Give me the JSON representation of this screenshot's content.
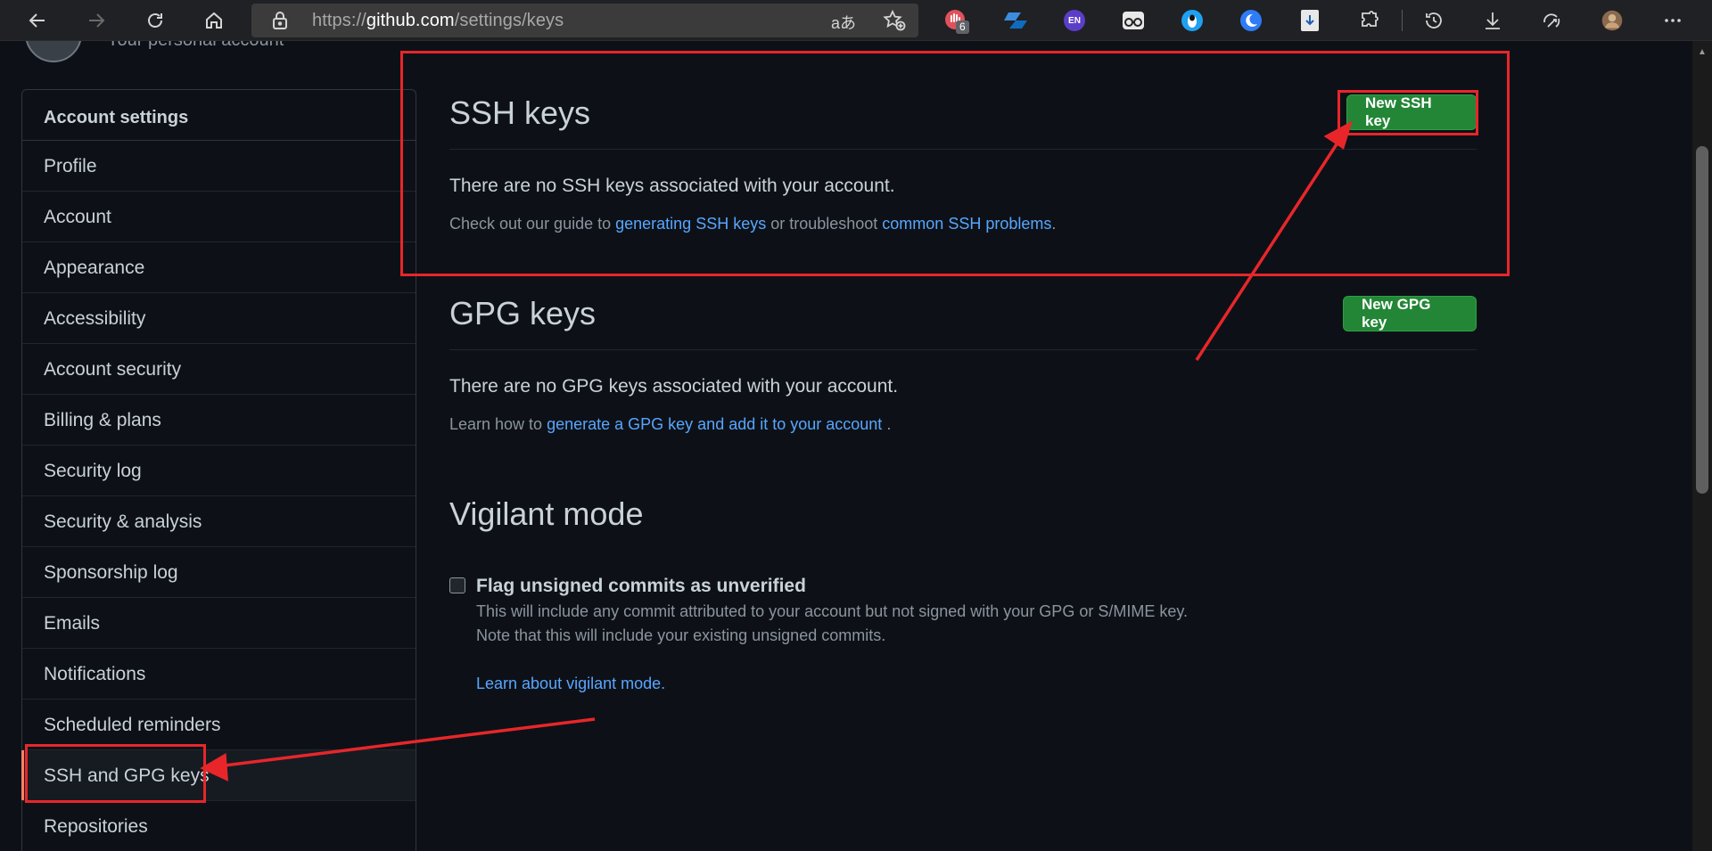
{
  "browser": {
    "url_prefix": "https://",
    "url_host": "github.com",
    "url_path": "/settings/keys",
    "read_aloud": "aあ",
    "ext_badge_count": "6",
    "ext_en_label": "EN"
  },
  "profile": {
    "subtitle": "Your personal account"
  },
  "sidebar": {
    "heading": "Account settings",
    "items": [
      {
        "label": "Profile"
      },
      {
        "label": "Account"
      },
      {
        "label": "Appearance"
      },
      {
        "label": "Accessibility"
      },
      {
        "label": "Account security"
      },
      {
        "label": "Billing & plans"
      },
      {
        "label": "Security log"
      },
      {
        "label": "Security & analysis"
      },
      {
        "label": "Sponsorship log"
      },
      {
        "label": "Emails"
      },
      {
        "label": "Notifications"
      },
      {
        "label": "Scheduled reminders"
      },
      {
        "label": "SSH and GPG keys"
      },
      {
        "label": "Repositories"
      }
    ]
  },
  "ssh": {
    "title": "SSH keys",
    "new_button": "New SSH key",
    "empty": "There are no SSH keys associated with your account.",
    "guide_prefix": "Check out our guide to ",
    "guide_link1": "generating SSH keys",
    "guide_middle": " or troubleshoot ",
    "guide_link2": "common SSH problems",
    "guide_suffix": "."
  },
  "gpg": {
    "title": "GPG keys",
    "new_button": "New GPG key",
    "empty": "There are no GPG keys associated with your account.",
    "learn_prefix": "Learn how to ",
    "learn_link": "generate a GPG key and add it to your account",
    "learn_suffix": " ."
  },
  "vigilant": {
    "title": "Vigilant mode",
    "checkbox_label": "Flag unsigned commits as unverified",
    "checked": false,
    "note1": "This will include any commit attributed to your account but not signed with your GPG or S/MIME key.",
    "note2": "Note that this will include your existing unsigned commits.",
    "link": "Learn about vigilant mode."
  },
  "colors": {
    "annotation": "#e8262a",
    "primary_button": "#238636",
    "link": "#58a6ff",
    "background": "#0d1117"
  }
}
